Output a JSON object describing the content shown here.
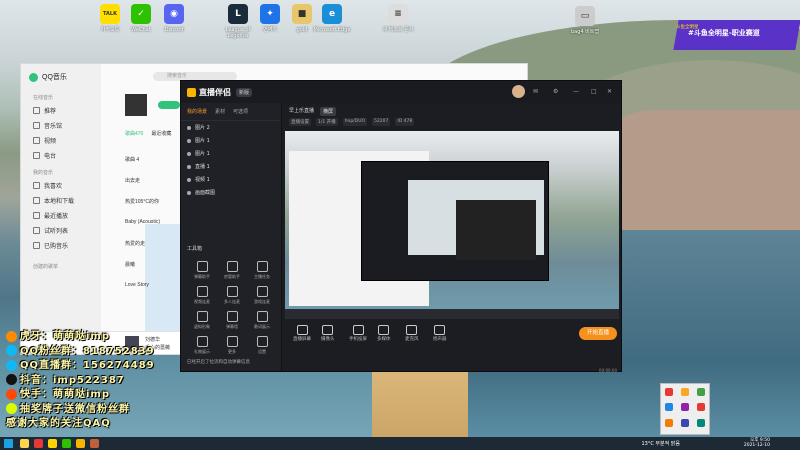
{
  "desktop": {
    "icons": [
      {
        "label": "카카오톡",
        "color": "#ffde00",
        "glyph": "TALK"
      },
      {
        "label": "WeChat",
        "color": "#2dc100",
        "glyph": "✓"
      },
      {
        "label": "Discord",
        "color": "#5865f2",
        "glyph": "◉"
      },
      {
        "label": "League of Legends",
        "color": "#1a2b3c",
        "glyph": "L"
      },
      {
        "label": "번역기",
        "color": "#1e73e8",
        "glyph": "✦"
      },
      {
        "label": "gold",
        "color": "#e8c76a",
        "glyph": "■"
      },
      {
        "label": "Microsoft Edge",
        "color": "#1a8fd8",
        "glyph": "e"
      },
      {
        "label": "새 텍스트 문서",
        "color": "#dddddd",
        "glyph": "≡"
      },
      {
        "label": "bag4 비트맵",
        "color": "#cccccc",
        "glyph": "▭"
      }
    ]
  },
  "qqmusic": {
    "title": "QQ音乐",
    "search_placeholder": "搜索音乐",
    "sections": [
      {
        "head": "在线音乐",
        "items": [
          "推荐",
          "音乐馆",
          "视频",
          "电台"
        ]
      },
      {
        "head": "我的音乐",
        "items": [
          "我喜欢",
          "本地和下载",
          "最近播放",
          "试听列表",
          "已购音乐"
        ]
      }
    ],
    "playlist_head": "创建的歌单",
    "tabs": [
      "歌曲470",
      "最近收藏"
    ],
    "rows": [
      "歌曲 4",
      "出去走",
      "热爱105°C的你",
      "Baby (Acoustic)",
      "热爱的走",
      "晨曦",
      "Love Story"
    ],
    "now_playing": "手心的蔷薇",
    "artist": "刘德华"
  },
  "studio": {
    "app_name": "直播伴侣",
    "version": "新版",
    "left_tabs": [
      "我的场景",
      "素材",
      "可选项"
    ],
    "scenes": [
      "图片 2",
      "图片 1",
      "图片 1",
      "直播 1",
      "视频 1",
      "画面截图"
    ],
    "tools_head": "工具箱",
    "tools": [
      "弹幕助手",
      "房管助手",
      "主播任务",
      "视频连麦",
      "多人连麦",
      "游戏连麦",
      "虚拟形象",
      "弹幕墙",
      "歌词展示",
      "礼物展示",
      "更多",
      "设置"
    ],
    "footer_note": "已经开启了拉流和自动弹幕信息",
    "top_title": "早上乐直播",
    "top_tag": "横屏",
    "info": [
      "直播设置",
      "1/1 开播",
      "hnp/DUO",
      "52207",
      "ID 478"
    ],
    "bottom_buttons": [
      "直播屏幕",
      "摄像头",
      "手机投屏",
      "多媒体",
      "麦克风",
      "扬声器"
    ],
    "go_live": "开始直播",
    "status": "00:00:00"
  },
  "banner": {
    "tag": "斗鱼全明星",
    "text": "#斗鱼全明星-职业赛道"
  },
  "overlay": [
    {
      "label": "虎牙：萌萌哒imp",
      "badge": "#ff8a00"
    },
    {
      "label": "QQ粉丝群：818752839",
      "badge": "#12b7f5"
    },
    {
      "label": "QQ直播群：156274489",
      "badge": "#12b7f5"
    },
    {
      "label": "抖音：imp522387",
      "badge": "#111111"
    },
    {
      "label": "快手：萌萌哒imp",
      "badge": "#ff4906"
    },
    {
      "label": "抽奖牌子送微信粉丝群",
      "badge": "#d9fd00"
    },
    {
      "label": "感谢大家的关注QAQ",
      "badge": ""
    }
  ],
  "taskbar": {
    "weather": "13°C 부분적 맑음",
    "time": "오후 9:50",
    "date": "2021-12-10",
    "tray_colors": [
      "#e53935",
      "#f9a825",
      "#43a047",
      "#1e88e5",
      "#8e24aa",
      "#e53935",
      "#f57c00",
      "#3949ab",
      "#00897b"
    ]
  }
}
